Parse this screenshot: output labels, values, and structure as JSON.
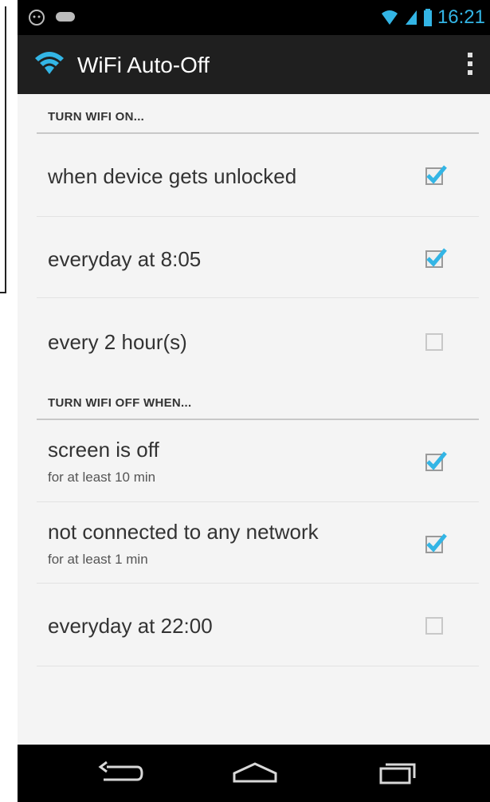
{
  "status_bar": {
    "time": "16:21",
    "notification_icons": [
      "android-robot-icon",
      "game-controller-icon"
    ],
    "status_icons": [
      "wifi-signal-icon",
      "cell-signal-icon",
      "battery-icon"
    ]
  },
  "action_bar": {
    "title": "WiFi Auto-Off",
    "app_icon": "wifi-icon",
    "overflow_icon": "overflow-menu-icon"
  },
  "sections": [
    {
      "header": "TURN WIFI ON...",
      "items": [
        {
          "title": "when device gets unlocked",
          "summary": "",
          "checked": true
        },
        {
          "title": "everyday at 8:05",
          "summary": "",
          "checked": true
        },
        {
          "title": "every 2 hour(s)",
          "summary": "",
          "checked": false
        }
      ]
    },
    {
      "header": "TURN WIFI OFF WHEN...",
      "items": [
        {
          "title": "screen is off",
          "summary": "for at least 10 min",
          "checked": true
        },
        {
          "title": "not connected to any network",
          "summary": "for at least 1 min",
          "checked": true
        },
        {
          "title": "everyday at 22:00",
          "summary": "",
          "checked": false
        }
      ]
    }
  ],
  "nav_bar": {
    "buttons": [
      "back-icon",
      "home-icon",
      "recent-apps-icon"
    ]
  },
  "colors": {
    "accent": "#33b5e5",
    "action_bar": "#1f1f1f",
    "background": "#f4f4f4"
  }
}
